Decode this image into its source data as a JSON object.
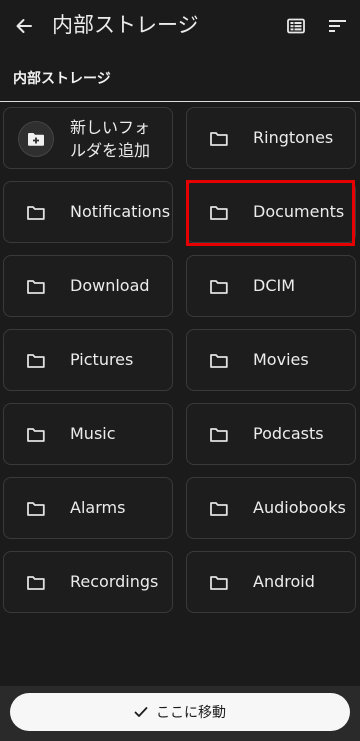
{
  "header": {
    "title": "内部ストレージ",
    "back_icon": "arrow-back-icon",
    "view_icon": "list-view-icon",
    "sort_icon": "sort-icon"
  },
  "breadcrumb": {
    "label": "内部ストレージ"
  },
  "new_folder": {
    "label_line1": "新しいフォ",
    "label_line2": "ルダを追加",
    "icon": "create-folder-icon"
  },
  "folders": [
    {
      "label": "Ringtones"
    },
    {
      "label": "Notifications"
    },
    {
      "label": "Documents"
    },
    {
      "label": "Download"
    },
    {
      "label": "DCIM"
    },
    {
      "label": "Pictures"
    },
    {
      "label": "Movies"
    },
    {
      "label": "Music"
    },
    {
      "label": "Podcasts"
    },
    {
      "label": "Alarms"
    },
    {
      "label": "Audiobooks"
    },
    {
      "label": "Recordings"
    },
    {
      "label": "Android"
    }
  ],
  "bottom": {
    "move_label": "ここに移動",
    "check_icon": "check-icon"
  },
  "colors": {
    "background": "#1b1b1b",
    "tile_border": "#3a3a3a",
    "highlight": "#e60000",
    "button_bg": "#f7f7f7"
  }
}
